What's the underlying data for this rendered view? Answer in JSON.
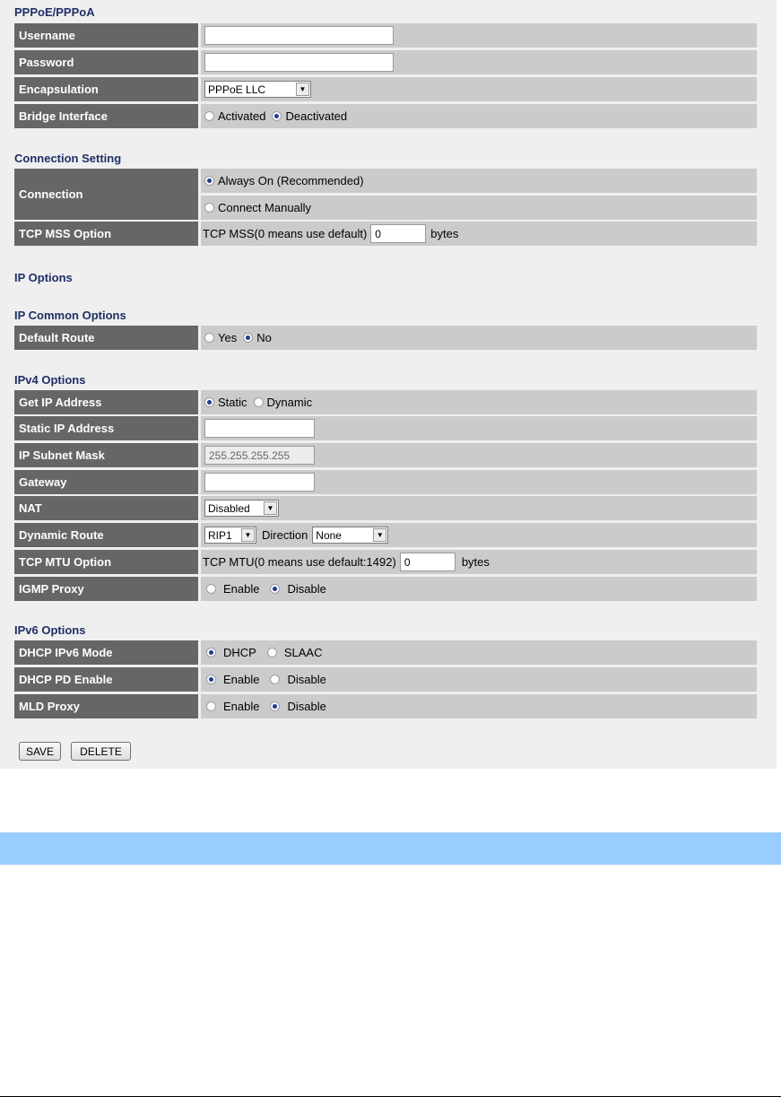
{
  "sections": {
    "pppoe": "PPPoE/PPPoA",
    "connection_setting": "Connection Setting",
    "ip_options": "IP Options",
    "ip_common": "IP Common Options",
    "ipv4": "IPv4 Options",
    "ipv6": "IPv6 Options"
  },
  "pppoe": {
    "username_label": "Username",
    "username_value": "",
    "password_label": "Password",
    "password_value": "",
    "encapsulation_label": "Encapsulation",
    "encapsulation_value": "PPPoE LLC",
    "bridge_label": "Bridge Interface",
    "bridge_options": [
      "Activated",
      "Deactivated"
    ],
    "bridge_selected": "Deactivated"
  },
  "connection": {
    "connection_label": "Connection",
    "always_on": "Always On (Recommended)",
    "connect_manually": "Connect Manually",
    "selected": "Always On (Recommended)",
    "tcp_mss_label": "TCP MSS Option",
    "tcp_mss_text": "TCP MSS(0 means use default)",
    "tcp_mss_value": "0",
    "tcp_mss_unit": "bytes"
  },
  "common": {
    "default_route_label": "Default Route",
    "options": [
      "Yes",
      "No"
    ],
    "selected": "No"
  },
  "ipv4": {
    "get_ip_label": "Get IP Address",
    "get_ip_options": [
      "Static",
      "Dynamic"
    ],
    "get_ip_selected": "Static",
    "static_ip_label": "Static IP Address",
    "static_ip_value": "",
    "subnet_label": "IP Subnet Mask",
    "subnet_value": "255.255.255.255",
    "gateway_label": "Gateway",
    "gateway_value": "",
    "nat_label": "NAT",
    "nat_value": "Disabled",
    "dynamic_route_label": "Dynamic Route",
    "dynamic_route_value": "RIP1",
    "direction_label": "Direction",
    "direction_value": "None",
    "tcp_mtu_label": "TCP MTU Option",
    "tcp_mtu_text": "TCP MTU(0 means use default:1492)",
    "tcp_mtu_value": "0",
    "tcp_mtu_unit": "bytes",
    "igmp_label": "IGMP Proxy",
    "igmp_options": [
      "Enable",
      "Disable"
    ],
    "igmp_selected": "Disable"
  },
  "ipv6": {
    "dhcp_mode_label": "DHCP IPv6 Mode",
    "dhcp_mode_options": [
      "DHCP",
      "SLAAC"
    ],
    "dhcp_mode_selected": "DHCP",
    "dhcp_pd_label": "DHCP PD Enable",
    "dhcp_pd_options": [
      "Enable",
      "Disable"
    ],
    "dhcp_pd_selected": "Enable",
    "mld_label": "MLD Proxy",
    "mld_options": [
      "Enable",
      "Disable"
    ],
    "mld_selected": "Disable"
  },
  "buttons": {
    "save": "SAVE",
    "delete": "DELETE"
  },
  "colors": {
    "panel_bg": "#efefef",
    "label_bg": "#666666",
    "value_bg": "#cbcbcb",
    "section_title": "#1f2f66",
    "bottom_bar": "#99ccff"
  }
}
